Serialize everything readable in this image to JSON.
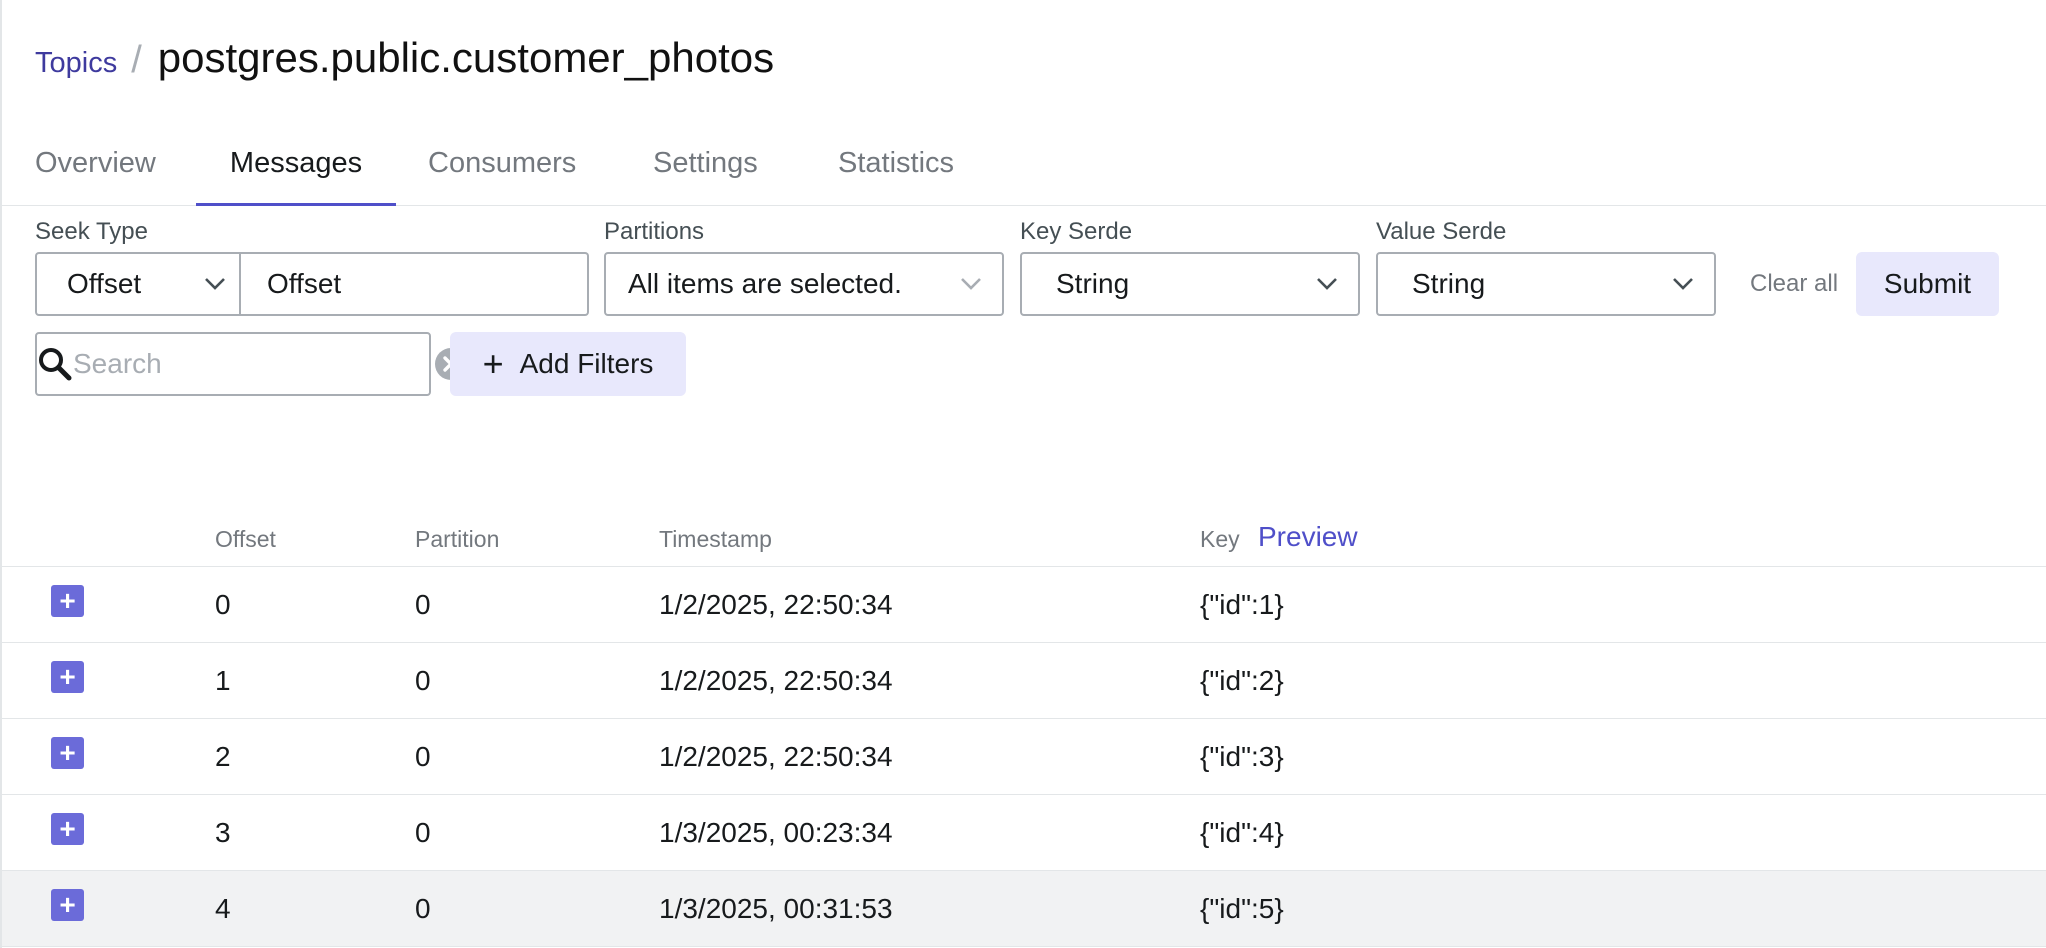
{
  "breadcrumb": {
    "parent": "Topics",
    "separator": "/",
    "current": "postgres.public.customer_photos"
  },
  "tabs": [
    {
      "label": "Overview"
    },
    {
      "label": "Messages"
    },
    {
      "label": "Consumers"
    },
    {
      "label": "Settings"
    },
    {
      "label": "Statistics"
    }
  ],
  "active_tab": "Messages",
  "filters": {
    "seek_type_label": "Seek Type",
    "seek_type_value": "Offset",
    "offset_value": "Offset",
    "partitions_label": "Partitions",
    "partitions_value": "All items are selected.",
    "key_serde_label": "Key Serde",
    "key_serde_value": "String",
    "value_serde_label": "Value Serde",
    "value_serde_value": "String",
    "clear_all": "Clear all",
    "submit": "Submit"
  },
  "search": {
    "placeholder": "Search"
  },
  "add_filters": {
    "plus": "+",
    "label": "Add Filters"
  },
  "table": {
    "columns": {
      "offset": "Offset",
      "partition": "Partition",
      "timestamp": "Timestamp",
      "key": "Key"
    },
    "preview": "Preview",
    "expand_symbol": "+",
    "rows": [
      {
        "offset": "0",
        "partition": "0",
        "timestamp": "1/2/2025, 22:50:34",
        "key": "{\"id\":1}"
      },
      {
        "offset": "1",
        "partition": "0",
        "timestamp": "1/2/2025, 22:50:34",
        "key": "{\"id\":2}"
      },
      {
        "offset": "2",
        "partition": "0",
        "timestamp": "1/2/2025, 22:50:34",
        "key": "{\"id\":3}"
      },
      {
        "offset": "3",
        "partition": "0",
        "timestamp": "1/3/2025, 00:23:34",
        "key": "{\"id\":4}"
      },
      {
        "offset": "4",
        "partition": "0",
        "timestamp": "1/3/2025, 00:31:53",
        "key": "{\"id\":5}"
      }
    ]
  },
  "colors": {
    "accent": "#4f4fc9",
    "button_bg": "#e8e8fc",
    "expand_button": "#6b6bd9",
    "link": "#3e3a9e"
  }
}
